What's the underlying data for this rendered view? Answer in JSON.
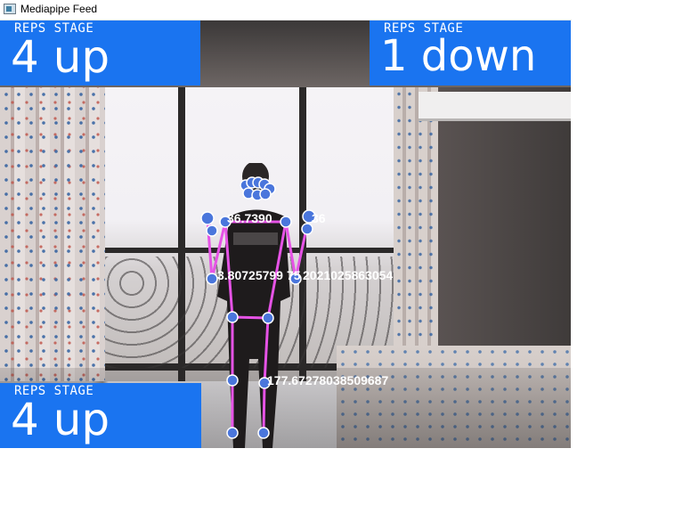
{
  "window": {
    "title": "Mediapipe Feed"
  },
  "panels": {
    "top_left": {
      "label": "REPS  STAGE",
      "value": "4 up"
    },
    "top_right": {
      "label": "REPS  STAGE",
      "value": "1 down"
    },
    "bottom_left": {
      "label": "REPS  STAGE",
      "value": "4 up"
    }
  },
  "pose_overlay": {
    "angle_labels": [
      "36.7390",
      "36",
      "3.80725799",
      "75",
      "2021025863054",
      "177.67278038509687"
    ],
    "colors": {
      "skeleton_line": "#e653e6",
      "landmark_fill": "#4a76dc",
      "landmark_ring": "#ffffff",
      "label_text": "#ffffff",
      "panel_bg": "#1a74f0"
    }
  },
  "icons": {
    "app_icon": "app-window-icon"
  }
}
